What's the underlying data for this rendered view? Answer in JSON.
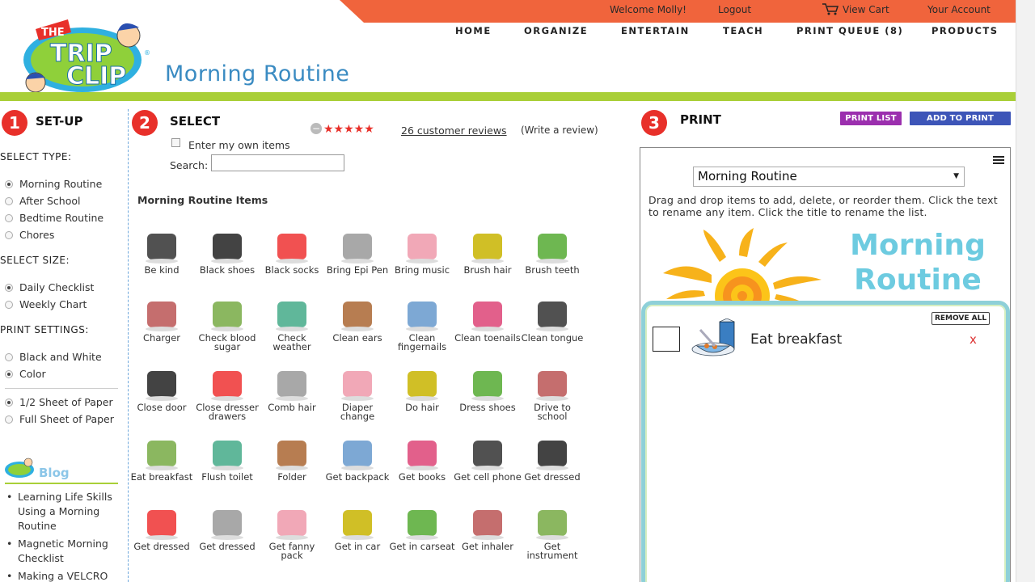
{
  "header": {
    "welcome": "Welcome Molly!",
    "logout": "Logout",
    "view_cart": "View Cart",
    "account": "Your Account",
    "nav": [
      "HOME",
      "ORGANIZE",
      "ENTERTAIN",
      "TEACH",
      "PRINT QUEUE (8)",
      "PRODUCTS"
    ],
    "logo_text": [
      "THE",
      "TRIP",
      "CLIP"
    ],
    "page_title": "Morning Routine"
  },
  "colors": {
    "topbar": "#f0643c",
    "green": "#a9cf38",
    "step": "#e8302a",
    "title_blue": "#3a8bc2",
    "print_list": "#9b2fae",
    "add_queue": "#3d55b8"
  },
  "setup": {
    "num": "1",
    "label": "SET-UP",
    "type_heading": "SELECT TYPE:",
    "types": [
      "Morning Routine",
      "After School",
      "Bedtime Routine",
      "Chores"
    ],
    "size_heading": "SELECT SIZE:",
    "sizes": [
      "Daily Checklist",
      "Weekly Chart"
    ],
    "print_heading": "PRINT SETTINGS:",
    "colors": [
      "Black and White",
      "Color"
    ],
    "paper": [
      "1/2 Sheet of Paper",
      "Full Sheet of Paper"
    ],
    "blog_title": "Blog",
    "blog_items": [
      "Learning Life Skills Using a Morning Routine",
      "Magnetic Morning Checklist",
      "Making a VELCRO"
    ]
  },
  "select": {
    "num": "2",
    "label": "SELECT",
    "reviews": "26 customer reviews",
    "write_review": "(Write a review)",
    "rating": 5,
    "own_items": "Enter my own items",
    "search_label": "Search:",
    "search_value": "",
    "items_title": "Morning Routine Items",
    "items": [
      [
        "Be kind",
        "Black shoes",
        "Black socks",
        "Bring Epi Pen",
        "Bring music",
        "Brush hair",
        "Brush teeth"
      ],
      [
        "Charger",
        "Check blood sugar",
        "Check weather",
        "Clean ears",
        "Clean fingernails",
        "Clean toenails",
        "Clean tongue"
      ],
      [
        "Close door",
        "Close dresser drawers",
        "Comb hair",
        "Diaper change",
        "Do hair",
        "Dress shoes",
        "Drive to school"
      ],
      [
        "Eat breakfast",
        "Flush toilet",
        "Folder",
        "Get backpack",
        "Get books",
        "Get cell phone",
        "Get dressed"
      ],
      [
        "Get dressed",
        "Get dressed",
        "Get fanny pack",
        "Get in car",
        "Get in carseat",
        "Get inhaler",
        "Get instrument"
      ]
    ]
  },
  "print": {
    "num": "3",
    "label": "PRINT",
    "print_list": "PRINT LIST",
    "add_queue": "ADD TO PRINT QUEUE",
    "dropdown_value": "Morning Routine",
    "instructions": "Drag and drop items to add, delete, or reorder them. Click the text to rename any item. Click the title to rename the list.",
    "chart_title": "Morning Routine",
    "remove_all": "REMOVE ALL",
    "list_items": [
      "Eat breakfast"
    ],
    "remove_mark": "x"
  }
}
